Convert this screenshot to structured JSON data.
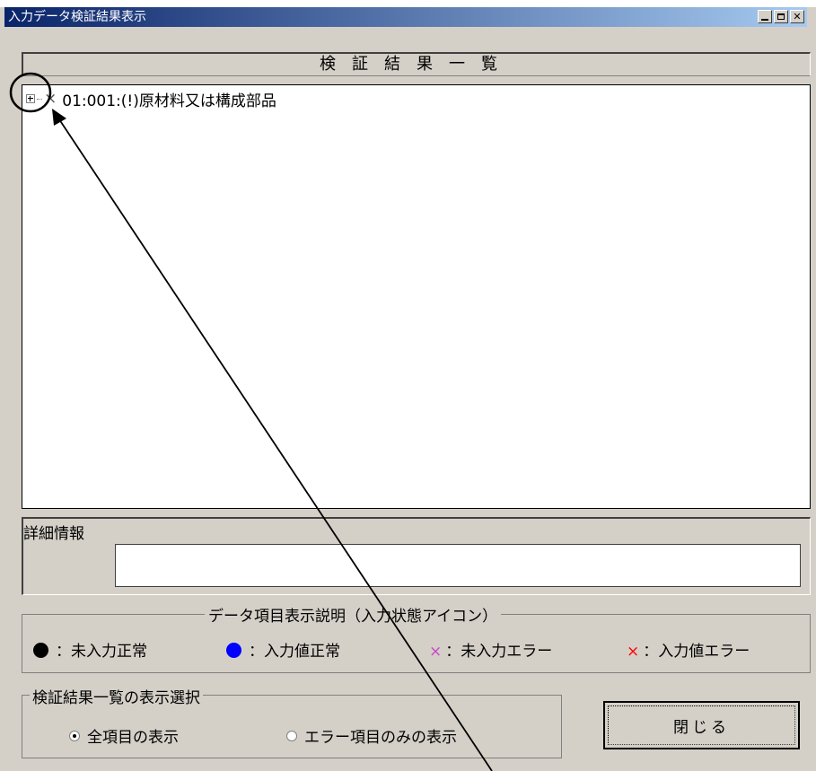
{
  "window": {
    "title": "入力データ検証結果表示",
    "min_icon": "minimize-icon",
    "max_icon": "maximize-icon",
    "close_glyph": "✕"
  },
  "results": {
    "header": "検証結果一覧",
    "items": [
      {
        "status_glyph": "×",
        "label": "01:001:(!)原材料又は構成部品"
      }
    ]
  },
  "detail": {
    "label": "詳細情報",
    "value": ""
  },
  "legend": {
    "title": "データ項目表示説明（入力状態アイコン）",
    "items": [
      {
        "glyph": "●",
        "color": "#000000",
        "label": "：未入力正常"
      },
      {
        "glyph": "●",
        "color": "#0000ff",
        "label": "：入力値正常"
      },
      {
        "glyph": "×",
        "color": "#cc44cc",
        "label": "：未入力エラー"
      },
      {
        "glyph": "×",
        "color": "#ff0000",
        "label": "：入力値エラー"
      }
    ]
  },
  "selection": {
    "title": "検証結果一覧の表示選択",
    "options": [
      {
        "label": "全項目の表示",
        "selected": true
      },
      {
        "label": "エラー項目のみの表示",
        "selected": false
      }
    ]
  },
  "close_button": {
    "label": "閉じる"
  },
  "colors": {
    "window_bg": "#d4d0c8",
    "title_start": "#0a246a",
    "title_end": "#a6caf0"
  }
}
